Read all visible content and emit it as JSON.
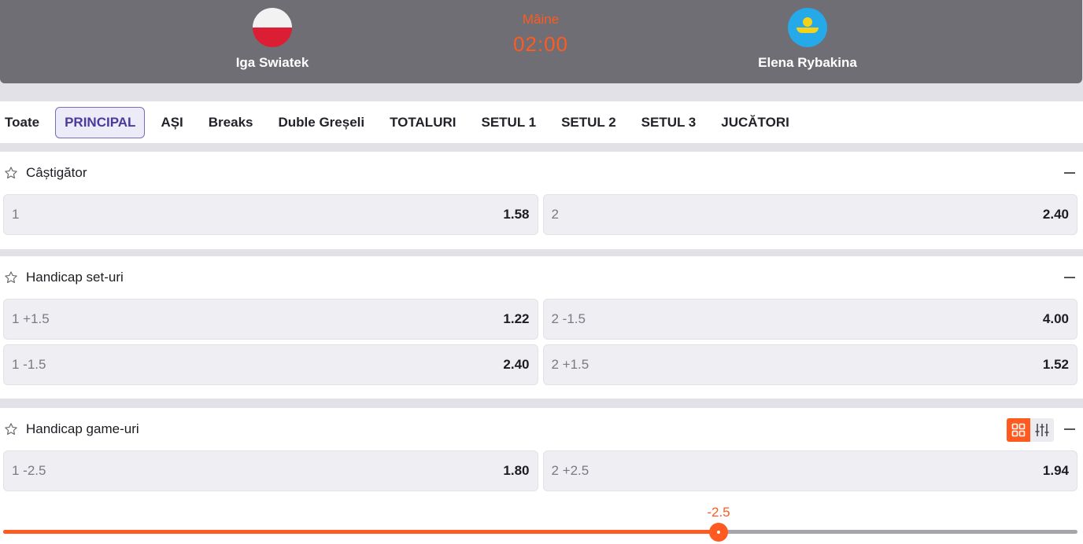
{
  "match": {
    "home": {
      "name": "Iga Swiatek",
      "flag_icon": "poland-flag-icon"
    },
    "away": {
      "name": "Elena Rybakina",
      "flag_icon": "kazakhstan-flag-icon"
    },
    "day": "Mâine",
    "time": "02:00"
  },
  "tabs": [
    {
      "label": "Toate",
      "active": false
    },
    {
      "label": "PRINCIPAL",
      "active": true
    },
    {
      "label": "AȘI",
      "active": false
    },
    {
      "label": "Breaks",
      "active": false
    },
    {
      "label": "Duble Greșeli",
      "active": false
    },
    {
      "label": "TOTALURI",
      "active": false
    },
    {
      "label": "SETUL 1",
      "active": false
    },
    {
      "label": "SETUL 2",
      "active": false
    },
    {
      "label": "SETUL 3",
      "active": false
    },
    {
      "label": "JUCĂTORI",
      "active": false
    }
  ],
  "markets": {
    "winner": {
      "title": "Câștigător",
      "rows": [
        [
          {
            "label": "1",
            "value": "1.58"
          },
          {
            "label": "2",
            "value": "2.40"
          }
        ]
      ]
    },
    "set_handicap": {
      "title": "Handicap set-uri",
      "rows": [
        [
          {
            "label": "1 +1.5",
            "value": "1.22"
          },
          {
            "label": "2 -1.5",
            "value": "4.00"
          }
        ],
        [
          {
            "label": "1 -1.5",
            "value": "2.40"
          },
          {
            "label": "2 +1.5",
            "value": "1.52"
          }
        ]
      ]
    },
    "game_handicap": {
      "title": "Handicap game-uri",
      "rows": [
        [
          {
            "label": "1 -2.5",
            "value": "1.80"
          },
          {
            "label": "2 +2.5",
            "value": "1.94"
          }
        ]
      ],
      "slider": {
        "value_label": "-2.5",
        "fraction": 0.666
      }
    }
  },
  "colors": {
    "accent": "#ff5a1f",
    "header_bg": "#6f6e75",
    "active_tab": "#4b3a9c"
  }
}
